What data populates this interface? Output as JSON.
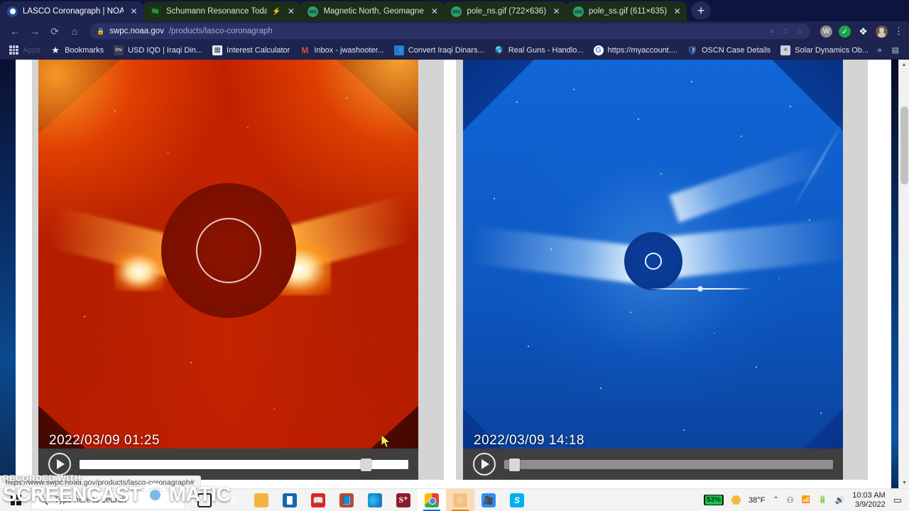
{
  "browser": {
    "tabs": [
      {
        "title": "LASCO Coronagraph | NOAA / N",
        "favicon": "noaa-icon",
        "active": true,
        "close": "✕"
      },
      {
        "title": "Schumann Resonance Today",
        "favicon": "flag-icon",
        "active": false,
        "close": "✕",
        "badge": "⚡"
      },
      {
        "title": "Magnetic North, Geomagnetic a",
        "favicon": "globe-icon",
        "active": false,
        "close": "✕"
      },
      {
        "title": "pole_ns.gif (722×636)",
        "favicon": "globe-icon",
        "active": false,
        "close": "✕"
      },
      {
        "title": "pole_ss.gif (611×635)",
        "favicon": "globe-icon",
        "active": false,
        "close": "✕"
      }
    ],
    "new_tab_label": "+",
    "nav": {
      "back": "←",
      "forward": "→",
      "reload": "⟳",
      "home": "⌂",
      "lock": "🔒",
      "url_domain": "swpc.noaa.gov",
      "url_path": "/products/lasco-coronagraph",
      "omni_search": "⌕",
      "omni_cast": "⌂",
      "omni_star": "☆",
      "menu": "⋮"
    },
    "extensions": [
      {
        "name": "wikipedia-extension-icon",
        "glyph": "W"
      },
      {
        "name": "checkmark-extension-icon",
        "glyph": "✓"
      },
      {
        "name": "puzzle-extensions-icon",
        "glyph": "❖"
      }
    ],
    "bookmarks": {
      "apps_label": "Apps",
      "items": [
        {
          "label": "Bookmarks",
          "icon": "star-icon"
        },
        {
          "label": "USD IQD | Iraqi Din...",
          "icon": "inv-icon"
        },
        {
          "label": "Interest Calculator",
          "icon": "calculator-icon"
        },
        {
          "label": "Inbox - jwashooter...",
          "icon": "gmail-icon"
        },
        {
          "label": "Convert Iraqi Dinars...",
          "icon": "people-icon"
        },
        {
          "label": "Real Guns - Handlo...",
          "icon": "globe-dark-icon"
        },
        {
          "label": "https://myaccount....",
          "icon": "google-icon"
        },
        {
          "label": "OSCN Case Details",
          "icon": "shield-icon"
        },
        {
          "label": "Solar Dynamics Ob...",
          "icon": "sun-icon"
        }
      ],
      "overflow": "»",
      "reading_list": "▤"
    },
    "status_url": "https://www.swpc.noaa.gov/products/lasco-coronagraph#"
  },
  "page": {
    "players": [
      {
        "name": "lasco-c3-red",
        "timestamp": "2022/03/09 01:25",
        "play_label": "▶",
        "progress_percent": 87,
        "track_style": "white"
      },
      {
        "name": "lasco-c3-blue",
        "timestamp": "2022/03/09 14:18",
        "play_label": "▶",
        "progress_percent": 2,
        "track_style": "gray"
      }
    ],
    "scrollbar": {
      "up": "▲",
      "down": "▼"
    }
  },
  "watermark": {
    "line1": "RECORDED WITH",
    "word1": "SCREENCAST",
    "word2": "MATIC"
  },
  "taskbar": {
    "search_placeholder": "Type here to search",
    "search_icon": "search-icon",
    "start_icon": "windows-start-icon",
    "cortana_icon": "cortana-circle-icon",
    "taskview_icon": "task-view-icon",
    "apps": [
      {
        "name": "file-explorer-icon",
        "glyph": ""
      },
      {
        "name": "microsoft-store-icon",
        "glyph": ""
      },
      {
        "name": "book-app-icon",
        "glyph": ""
      },
      {
        "name": "pdf-reader-icon",
        "glyph": ""
      },
      {
        "name": "microsoft-edge-icon",
        "glyph": ""
      },
      {
        "name": "stamps-app-icon",
        "glyph": "S⁺"
      },
      {
        "name": "google-chrome-icon",
        "glyph": ""
      },
      {
        "name": "screencast-o-matic-icon",
        "glyph": ""
      },
      {
        "name": "zoom-app-icon",
        "glyph": ""
      },
      {
        "name": "skype-app-icon",
        "glyph": "S"
      }
    ],
    "tray": {
      "battery_percent": "53%",
      "weather_temp": "38°F",
      "weather_icon": "sun-icon",
      "chevron": "⌃",
      "onedrive_icon": "⚇",
      "wifi_icon": "📶",
      "battery_icon": "🔋",
      "volume_icon": "🔊",
      "time": "10:03 AM",
      "date": "3/9/2022",
      "notifications_icon": "▭"
    }
  },
  "colors": {
    "chrome_bg": "#1d2450",
    "tabstrip_bg": "#0e1440",
    "green_tab": "#1c2e1a",
    "player_chrome": "#3f3f3f",
    "panel_gray": "#d4d4d4",
    "battery_green": "#17c44c",
    "taskbar_bg": "#f3f3f3"
  }
}
